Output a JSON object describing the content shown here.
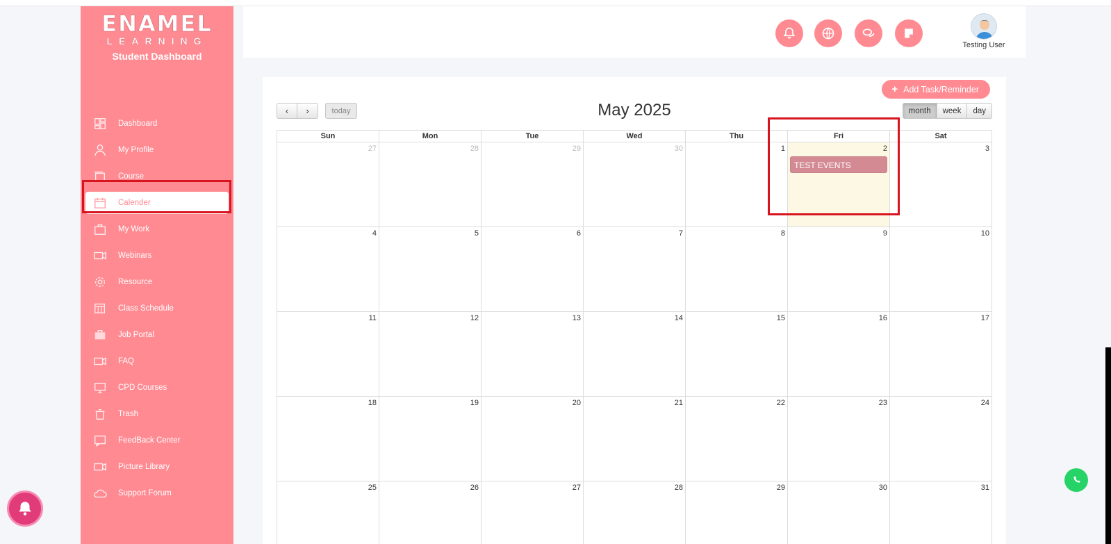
{
  "brand": {
    "logo_main": "ENAMEL",
    "logo_sub": "LEARNING",
    "dashboard_title": "Student Dashboard"
  },
  "sidebar": {
    "items": [
      {
        "label": "Dashboard",
        "icon": "dashboard-icon"
      },
      {
        "label": "My Profile",
        "icon": "user-icon"
      },
      {
        "label": "Course",
        "icon": "course-icon"
      },
      {
        "label": "Calender",
        "icon": "calendar-icon",
        "active": true
      },
      {
        "label": "My Work",
        "icon": "briefcase-icon"
      },
      {
        "label": "Webinars",
        "icon": "video-icon"
      },
      {
        "label": "Resource",
        "icon": "gear-icon"
      },
      {
        "label": "Class Schedule",
        "icon": "schedule-icon"
      },
      {
        "label": "Job Portal",
        "icon": "job-icon"
      },
      {
        "label": "FAQ",
        "icon": "video-icon"
      },
      {
        "label": "CPD Courses",
        "icon": "monitor-icon"
      },
      {
        "label": "Trash",
        "icon": "trash-icon"
      },
      {
        "label": "FeedBack Center",
        "icon": "feedback-icon"
      },
      {
        "label": "Picture Library",
        "icon": "video-icon"
      },
      {
        "label": "Support Forum",
        "icon": "cloud-icon"
      }
    ]
  },
  "header": {
    "buttons": [
      "bell-icon",
      "globe-icon",
      "chat-icon",
      "note-icon"
    ],
    "user_name": "Testing User"
  },
  "calendar": {
    "add_button": "Add Task/Reminder",
    "prev": "‹",
    "next": "›",
    "today": "today",
    "title": "May 2025",
    "views": [
      "month",
      "week",
      "day"
    ],
    "active_view": "month",
    "days_of_week": [
      "Sun",
      "Mon",
      "Tue",
      "Wed",
      "Thu",
      "Fri",
      "Sat"
    ],
    "weeks": [
      [
        {
          "n": "27",
          "other": true
        },
        {
          "n": "28",
          "other": true
        },
        {
          "n": "29",
          "other": true
        },
        {
          "n": "30",
          "other": true
        },
        {
          "n": "1"
        },
        {
          "n": "2",
          "today": true,
          "event": "TEST EVENTS"
        },
        {
          "n": "3"
        }
      ],
      [
        {
          "n": "4"
        },
        {
          "n": "5"
        },
        {
          "n": "6"
        },
        {
          "n": "7"
        },
        {
          "n": "8"
        },
        {
          "n": "9"
        },
        {
          "n": "10"
        }
      ],
      [
        {
          "n": "11"
        },
        {
          "n": "12"
        },
        {
          "n": "13"
        },
        {
          "n": "14"
        },
        {
          "n": "15"
        },
        {
          "n": "16"
        },
        {
          "n": "17"
        }
      ],
      [
        {
          "n": "18"
        },
        {
          "n": "19"
        },
        {
          "n": "20"
        },
        {
          "n": "21"
        },
        {
          "n": "22"
        },
        {
          "n": "23"
        },
        {
          "n": "24"
        }
      ],
      [
        {
          "n": "25"
        },
        {
          "n": "26"
        },
        {
          "n": "27"
        },
        {
          "n": "28"
        },
        {
          "n": "29"
        },
        {
          "n": "30"
        },
        {
          "n": "31"
        }
      ]
    ]
  },
  "colors": {
    "brand_pink": "#ff8a92",
    "event": "#d38a93",
    "today_bg": "#fcf8e3",
    "highlight": "#d8141f"
  }
}
